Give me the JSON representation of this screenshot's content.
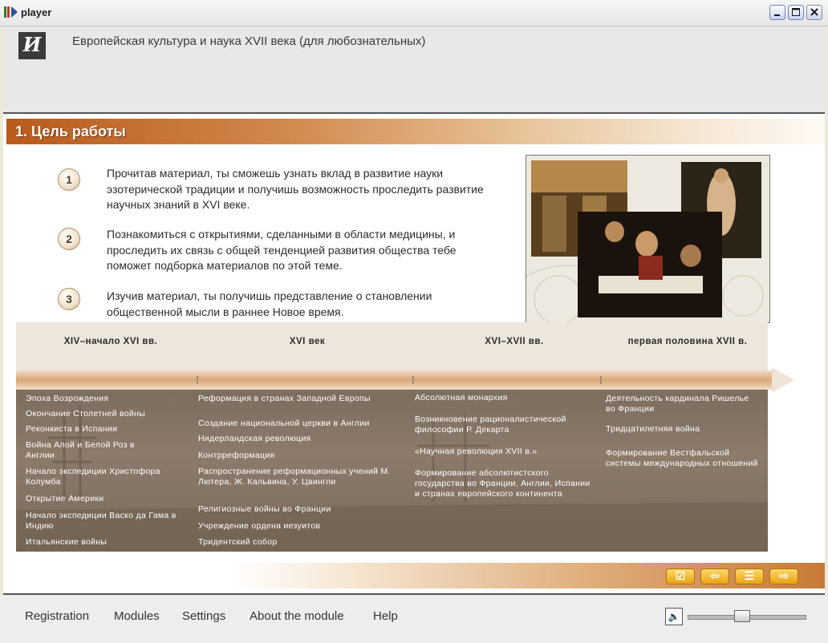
{
  "window": {
    "title": "player"
  },
  "header": {
    "logo_text": "И",
    "course_title": "Европейская культура и наука XVII века (для любознательных)"
  },
  "section": {
    "title": "1. Цель работы"
  },
  "goals": [
    {
      "num": "1",
      "text": "Прочитав материал, ты сможешь узнать вклад в развитие науки эзотерической традиции и получишь возможность проследить развитие научных знаний в XVI веке."
    },
    {
      "num": "2",
      "text": "Познакомиться с открытиями, сделанными в области медицины, и проследить их связь с общей тенденцией развития общества тебе поможет подборка материалов по этой теме."
    },
    {
      "num": "3",
      "text": "Изучив материал, ты получишь представление о становлении общественной мысли в раннее Новое время."
    }
  ],
  "timeline": {
    "periods": [
      "XIV–начало XVI вв.",
      "XVI век",
      "XVI–XVII вв.",
      "первая половина XVII в."
    ],
    "columns": [
      [
        "Эпоха Возрождения",
        "Окончание Столетней войны",
        "Реконкиста в Испании",
        "Война Алой и Белой Роз в Англии",
        "Начало экспедиции Христофора Колумба",
        "Открытие Америки",
        "Начало экспедиции Васко да Гама в Индию",
        "Итальянские войны"
      ],
      [
        "Реформация в странах Западной Европы",
        "Создание национальной церкви в Англии",
        "Нидерландская революция",
        "Контрреформация",
        "Распространение реформационных учений М. Лютера, Ж. Кальвина, У. Цвингли",
        "Религиозные войны во Франции",
        "Учреждение ордена иезуитов",
        "Тридентский собор"
      ],
      [
        "Абсолютная монархия",
        "Возникновение рационалистической философии Р. Декарта",
        "«Научная революция XVII в.»",
        "Формирование абсолютистского государства во Франции, Англии, Испании и странах европейского континента"
      ],
      [
        "Деятельность кардинала Ришелье во Франции",
        "Тридцатилетняя война",
        "Формирование Вестфальской системы международных отношений"
      ]
    ]
  },
  "nav": {
    "check": "☑",
    "prev": "⇦",
    "menu": "☰",
    "next": "⇨"
  },
  "footer": {
    "menu": [
      "Registration",
      "Modules",
      "Settings",
      "About the module",
      "Help"
    ],
    "speaker": "🔈",
    "volume": 0.45
  }
}
